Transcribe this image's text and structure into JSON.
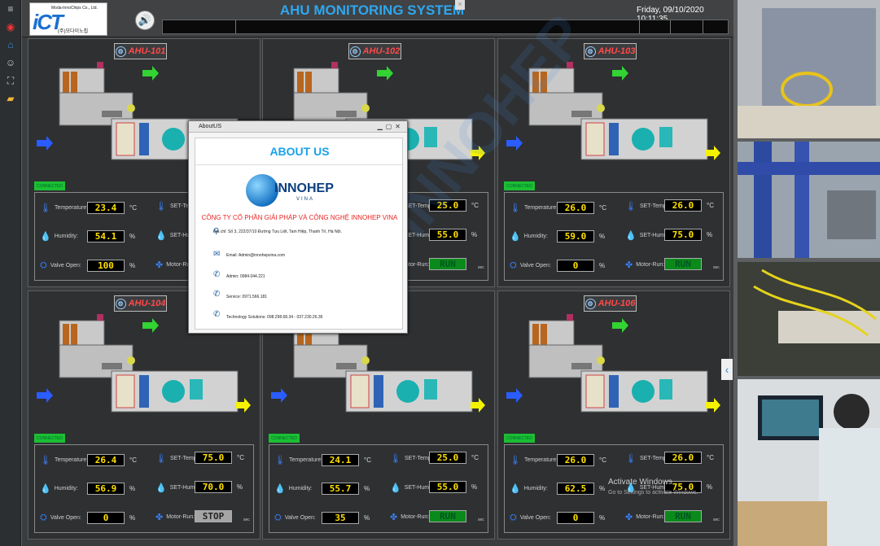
{
  "app": {
    "title": "AHU MONITORING SYSTEM",
    "datetime": "Friday, 09/10/2020 10:11:35",
    "logo_big": "iCT",
    "logo_small": "Moda-InnoChips Co., Ltd.",
    "logo_korean": "(주)모다이노칩",
    "close_glyph": "×"
  },
  "units": {
    "temp": "°C",
    "pct": "%",
    "sec": "sec"
  },
  "labels": {
    "temperature": "Temperature:",
    "humidity": "Humidity:",
    "valve": "Valve Open:",
    "set_temp": "SET-Temp:",
    "set_humi": "SET-Humi:",
    "motor": "Motor-Run:",
    "connected": "CONNECTED"
  },
  "panels": [
    {
      "name": "AHU-101",
      "temperature": "23.4",
      "humidity": "54.1",
      "valve": "100",
      "set_temp": "",
      "set_humi": "",
      "motor": ""
    },
    {
      "name": "AHU-102",
      "temperature": "",
      "humidity": "",
      "valve": "",
      "set_temp": "25.0",
      "set_humi": "55.0",
      "motor": "RUN"
    },
    {
      "name": "AHU-103",
      "temperature": "26.0",
      "humidity": "59.0",
      "valve": "0",
      "set_temp": "26.0",
      "set_humi": "75.0",
      "motor": "RUN"
    },
    {
      "name": "AHU-104",
      "temperature": "26.4",
      "humidity": "56.9",
      "valve": "0",
      "set_temp": "75.0",
      "set_humi": "70.0",
      "motor": "STOP"
    },
    {
      "name": "",
      "temperature": "24.1",
      "humidity": "55.7",
      "valve": "35",
      "set_temp": "25.0",
      "set_humi": "55.0",
      "motor": "RUN"
    },
    {
      "name": "AHU-106",
      "temperature": "26.0",
      "humidity": "62.5",
      "valve": "0",
      "set_temp": "26.0",
      "set_humi": "75.0",
      "motor": "RUN"
    }
  ],
  "about": {
    "window_title": "AboutUS",
    "heading": "ABOUT US",
    "brand": "INNOHEP",
    "brand_sub": "VINA",
    "company": "CÔNG TY CỔ PHẦN GIẢI PHÁP VÀ CÔNG NGHỆ INNOHEP VINA",
    "address": "Địa chỉ: Số 3, 222/37/10 Đường Tựu Liệt, Tam Hiệp, Thanh Trì, Hà Nội.",
    "email": "Email: Admin@innohepvina.com",
    "admin": "Admin: 0984.044.221",
    "service": "Service: 0971.566.181",
    "tech": "Technology Solutions: 098.298.68.34 - 037.230.26.36"
  },
  "windows_notice": {
    "line1": "Activate Windows",
    "line2": "Go to Settings to activate Windows."
  },
  "watermark": "INNOHEP",
  "icons": {
    "menu": "hamburger-icon",
    "speaker": "speaker-icon",
    "bell": "bell-icon",
    "thermometer": "thermometer-icon",
    "drop": "drop-icon",
    "valve": "valve-icon",
    "fan": "fan-icon"
  },
  "colors": {
    "title": "#2ea7f0",
    "panel_name": "#ff4a4a",
    "value": "#ffe000",
    "run": "#0a8a1a",
    "connected": "#1bbf33"
  }
}
